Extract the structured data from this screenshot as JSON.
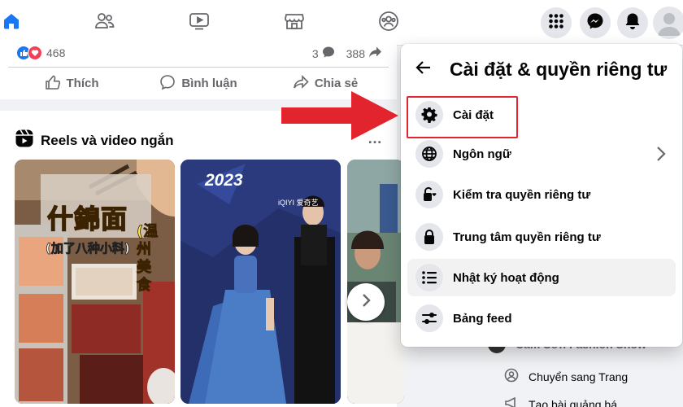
{
  "nav": {
    "tabs": [
      "home",
      "friends",
      "watch",
      "marketplace",
      "groups"
    ],
    "active_tab": "home",
    "accent": "#1877f2"
  },
  "post": {
    "reaction_count": "468",
    "comment_count": "3",
    "share_count": "388",
    "actions": {
      "like": "Thích",
      "comment": "Bình luận",
      "share": "Chia sẻ"
    }
  },
  "reels": {
    "title": "Reels và video ngắn",
    "card1_text_main": "什錦面",
    "card1_text_sub": "(加了八种小料)",
    "card1_text_side": "(温州美食",
    "card2_year": "2023",
    "card2_brand": "iQIYI 爱奇艺"
  },
  "menu": {
    "title": "Cài đặt & quyền riêng tư",
    "items": [
      {
        "label": "Cài đặt",
        "icon": "gear-icon"
      },
      {
        "label": "Ngôn ngữ",
        "icon": "globe-icon",
        "chevron": true
      },
      {
        "label": "Kiểm tra quyền riêng tư",
        "icon": "lock-heart-icon"
      },
      {
        "label": "Trung tâm quyền riêng tư",
        "icon": "lock-icon"
      },
      {
        "label": "Nhật ký hoạt động",
        "icon": "list-icon"
      },
      {
        "label": "Bảng feed",
        "icon": "sliders-icon"
      }
    ]
  },
  "right_column": {
    "page_name": "Cẩm Sơn Fashion Show",
    "switch_page": "Chuyển sang Trang",
    "create_ad": "Tạo bài quảng bá"
  },
  "annotation": {
    "arrow_color": "#e1242e"
  }
}
